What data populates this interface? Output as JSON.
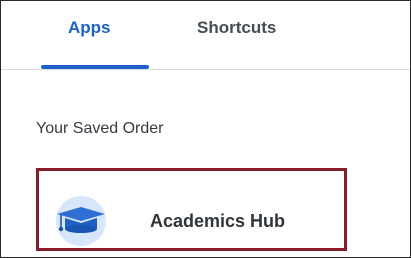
{
  "tabs": [
    {
      "label": "Apps",
      "active": true
    },
    {
      "label": "Shortcuts",
      "active": false
    }
  ],
  "colors": {
    "accent": "#1a62c9",
    "highlight_border": "#8a1d2c",
    "icon_bg": "#d6e6fb"
  },
  "section": {
    "label": "Your Saved Order"
  },
  "apps": [
    {
      "label": "Academics Hub",
      "icon": "graduation-cap-icon"
    }
  ]
}
